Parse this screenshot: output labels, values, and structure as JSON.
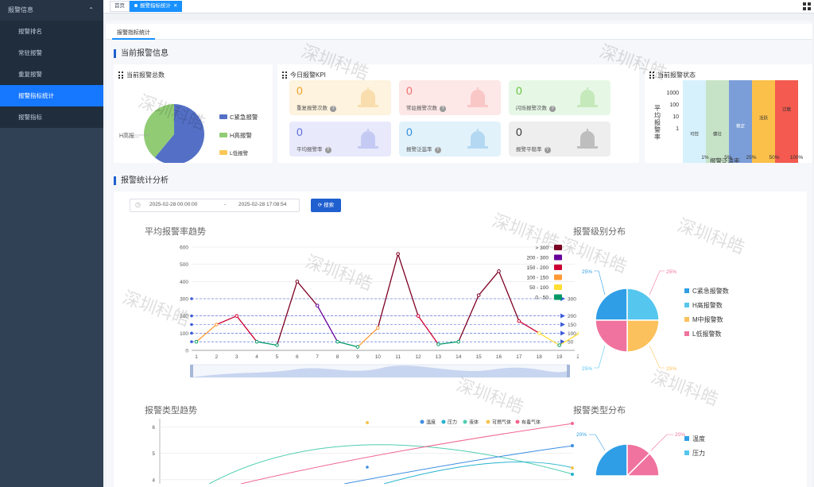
{
  "sidebar": {
    "group": "报警信息",
    "items": [
      {
        "label": "报警排名"
      },
      {
        "label": "常驻报警"
      },
      {
        "label": "重复报警"
      },
      {
        "label": "报警指标统计"
      },
      {
        "label": "报警指标"
      }
    ]
  },
  "tags": {
    "home": "首页",
    "current": "报警指标统计"
  },
  "tab": "报警指标统计",
  "section_current": "当前报警信息",
  "section_analysis": "报警统计分析",
  "total_card": {
    "title": "当前报警总数",
    "legend": [
      "C紧急报警",
      "H高报警",
      "L低报警"
    ],
    "slice_label": "H高报...",
    "colors": [
      "#5470c6",
      "#91cc75",
      "#fac858"
    ]
  },
  "kpi_card": {
    "title": "今日报警KPI"
  },
  "stats": [
    {
      "value": "0",
      "label": "重复报警次数",
      "bg": "#fdf3de",
      "color": "#f0a020"
    },
    {
      "value": "0",
      "label": "常驻报警次数",
      "bg": "#fde7e7",
      "color": "#f56c6c"
    },
    {
      "value": "0",
      "label": "闪烁报警次数",
      "bg": "#e6f7e6",
      "color": "#67c23a"
    },
    {
      "value": "0",
      "label": "平均报警率",
      "bg": "#e8eafc",
      "color": "#5b6cdc"
    },
    {
      "value": "0",
      "label": "报警泛滥率",
      "bg": "#e2f2fb",
      "color": "#2f8fd8"
    },
    {
      "value": "0",
      "label": "报警平稳率",
      "bg": "#eeeeee",
      "color": "#333333"
    }
  ],
  "state_card": {
    "title": "当前报警状态",
    "ylabel": "平均报警率",
    "xlabel": "报警泛滥率",
    "yticks": [
      "1000",
      "100",
      "10",
      "1"
    ],
    "xticks": [
      "1%",
      "5%",
      "25%",
      "50%",
      "100%"
    ],
    "zones": [
      {
        "label": "可控",
        "color": "#d6f1fb"
      },
      {
        "label": "健壮",
        "color": "#c6e3c8"
      },
      {
        "label": "稳定",
        "color": "#7b9ed8"
      },
      {
        "label": "活跃",
        "color": "#fbc04a"
      },
      {
        "label": "过载",
        "color": "#f45a4f"
      }
    ]
  },
  "datepicker": {
    "start": "2025-02-28 00:00:00",
    "sep": "-",
    "end": "2025-02-28 17:08:54"
  },
  "search_label": "搜索",
  "watermark": "深圳科皓",
  "chart_data": [
    {
      "type": "line",
      "title": "平均报警率趋势",
      "x": [
        1,
        2,
        3,
        4,
        5,
        6,
        7,
        8,
        9,
        10,
        11,
        12,
        13,
        14,
        15,
        16,
        17,
        18,
        19,
        20
      ],
      "series": [
        {
          "values": [
            50,
            150,
            200,
            50,
            30,
            400,
            260,
            50,
            20,
            130,
            560,
            200,
            35,
            50,
            320,
            460,
            170,
            100,
            30,
            100
          ]
        }
      ],
      "ylim": [
        0,
        600
      ],
      "yticks": [
        0,
        100,
        200,
        300,
        400,
        500,
        600
      ],
      "marklines": [
        300,
        200,
        150,
        100,
        50
      ],
      "visual_map": [
        {
          "label": "> 300",
          "color": "#7e0023"
        },
        {
          "label": "200 - 300",
          "color": "#660099"
        },
        {
          "label": "150 - 200",
          "color": "#cc0033"
        },
        {
          "label": "100 - 150",
          "color": "#ff9933"
        },
        {
          "label": "50 - 100",
          "color": "#ffde33"
        },
        {
          "label": "0 - 50",
          "color": "#096"
        }
      ]
    },
    {
      "type": "pie",
      "title": "报警级别分布",
      "categories": [
        "C紧急报警数",
        "H高报警数",
        "M中报警数",
        "L低报警数"
      ],
      "values": [
        25,
        25,
        25,
        25
      ],
      "labels": [
        "25%",
        "25%",
        "25%",
        "25%"
      ],
      "colors": [
        "#2f9ee6",
        "#55c6ee",
        "#fbc15d",
        "#f0739f"
      ]
    },
    {
      "type": "line",
      "title": "报警类型趋势",
      "legend": [
        "温度",
        "压力",
        "液体",
        "可燃气体",
        "有毒气体"
      ],
      "colors": [
        "#3d8ee2",
        "#24b2ce",
        "#4fcdb2",
        "#f7c551",
        "#f26690"
      ],
      "yticks": [
        4,
        5,
        6
      ],
      "ylim": [
        3.6,
        6.2
      ]
    },
    {
      "type": "pie",
      "title": "报警类型分布",
      "categories": [
        "温度",
        "压力"
      ],
      "labels": [
        "20%",
        "20%"
      ],
      "colors": [
        "#2f9ee6",
        "#f0739f"
      ]
    }
  ]
}
